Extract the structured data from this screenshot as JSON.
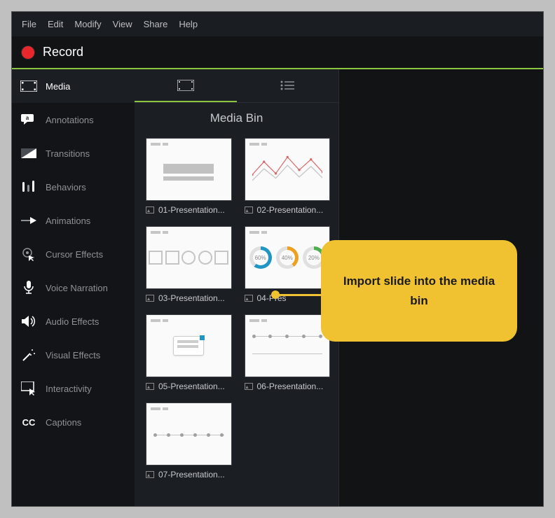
{
  "menu": [
    "File",
    "Edit",
    "Modify",
    "View",
    "Share",
    "Help"
  ],
  "record_label": "Record",
  "sidebar": {
    "items": [
      {
        "label": "Media"
      },
      {
        "label": "Annotations"
      },
      {
        "label": "Transitions"
      },
      {
        "label": "Behaviors"
      },
      {
        "label": "Animations"
      },
      {
        "label": "Cursor Effects"
      },
      {
        "label": "Voice Narration"
      },
      {
        "label": "Audio Effects"
      },
      {
        "label": "Visual Effects"
      },
      {
        "label": "Interactivity"
      },
      {
        "label": "Captions"
      }
    ]
  },
  "bin": {
    "title": "Media Bin",
    "items": [
      {
        "label": "01-Presentation..."
      },
      {
        "label": "02-Presentation..."
      },
      {
        "label": "03-Presentation..."
      },
      {
        "label": "04-Pres"
      },
      {
        "label": "05-Presentation..."
      },
      {
        "label": "06-Presentation..."
      },
      {
        "label": "07-Presentation..."
      }
    ]
  },
  "callout": {
    "text": "Import slide into the media bin"
  },
  "donuts": [
    "60%",
    "40%",
    "20%"
  ]
}
